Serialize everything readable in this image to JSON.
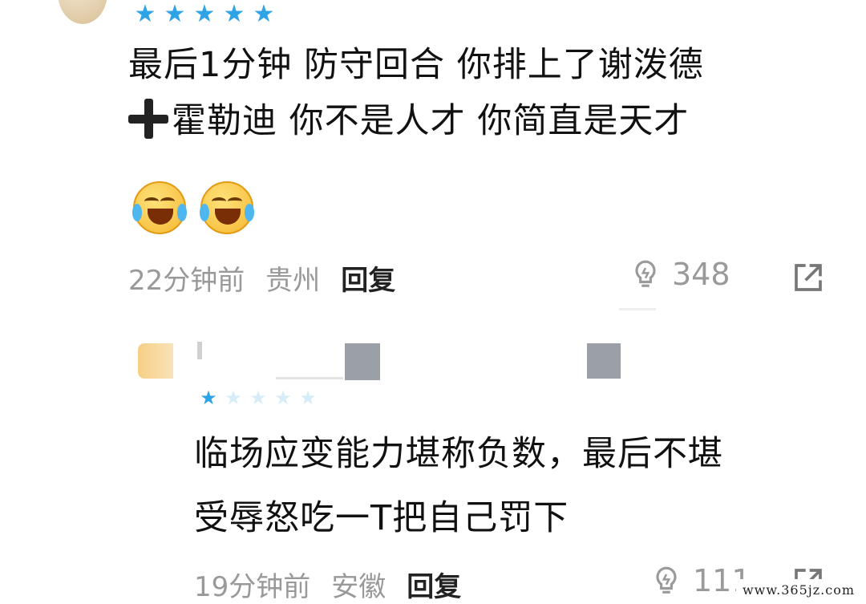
{
  "comments": [
    {
      "rating": 5,
      "text_lines": [
        "最后1分钟 防守回合 你排上了谢泼德",
        "霍勒迪 你不是人才 你简直是天才"
      ],
      "emojis": [
        "laughing-crying-face",
        "laughing-crying-face"
      ],
      "time": "22分钟前",
      "location": "贵州",
      "reply_label": "回复",
      "likes": "348"
    },
    {
      "rating": 1,
      "text_lines": [
        "临场应变能力堪称负数，最后不堪",
        "受辱怒吃一T把自己罚下"
      ],
      "time": "19分钟前",
      "location": "安徽",
      "reply_label": "回复",
      "likes": "111"
    }
  ],
  "watermark": "www.365jz.com",
  "colors": {
    "star": "#2ea4e6",
    "star_off": "#d6ecf7",
    "meta": "#999999"
  }
}
